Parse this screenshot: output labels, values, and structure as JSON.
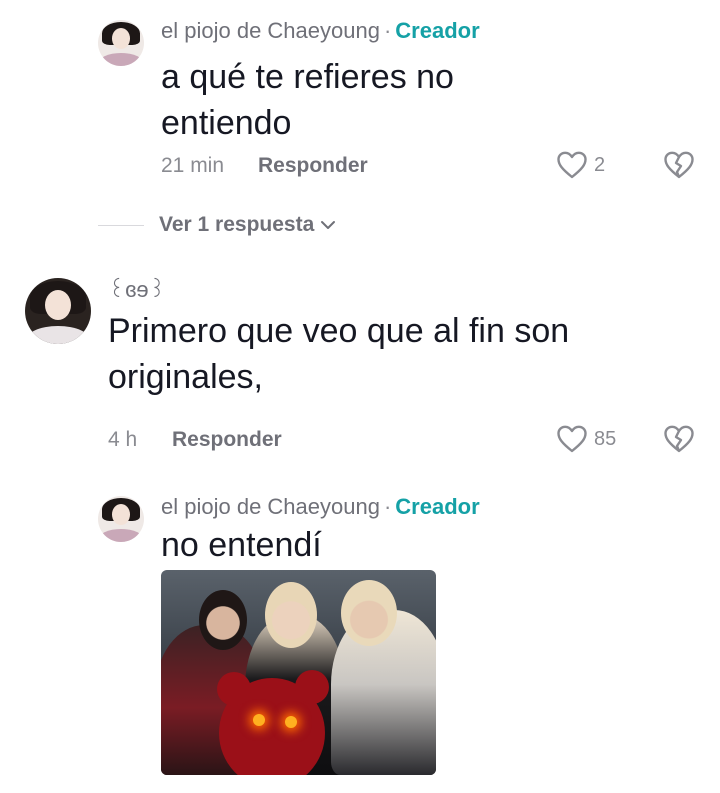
{
  "comments": [
    {
      "username": "el piojo de Chaeyoung",
      "separator": "·",
      "badge": "Creador",
      "text_line1": "a qué te refieres no",
      "text_line2": "entiendo",
      "time": "21 min",
      "reply_label": "Responder",
      "likes": "2",
      "view_replies": "Ver 1 respuesta"
    },
    {
      "username": "꒰ɞɘ꒱",
      "text_line1": "Primero que veo que al fin son",
      "text_line2": "originales,",
      "time": "4 h",
      "reply_label": "Responder",
      "likes": "85"
    },
    {
      "username": "el piojo de Chaeyoung",
      "separator": "·",
      "badge": "Creador",
      "text_line1": "no entendí"
    }
  ],
  "icons": {
    "like": "heart-outline-icon",
    "dislike": "broken-heart-icon",
    "expand": "chevron-down-icon"
  },
  "colors": {
    "creator_badge": "#15a1a6",
    "text": "#161823",
    "muted": "#8a8b91"
  }
}
